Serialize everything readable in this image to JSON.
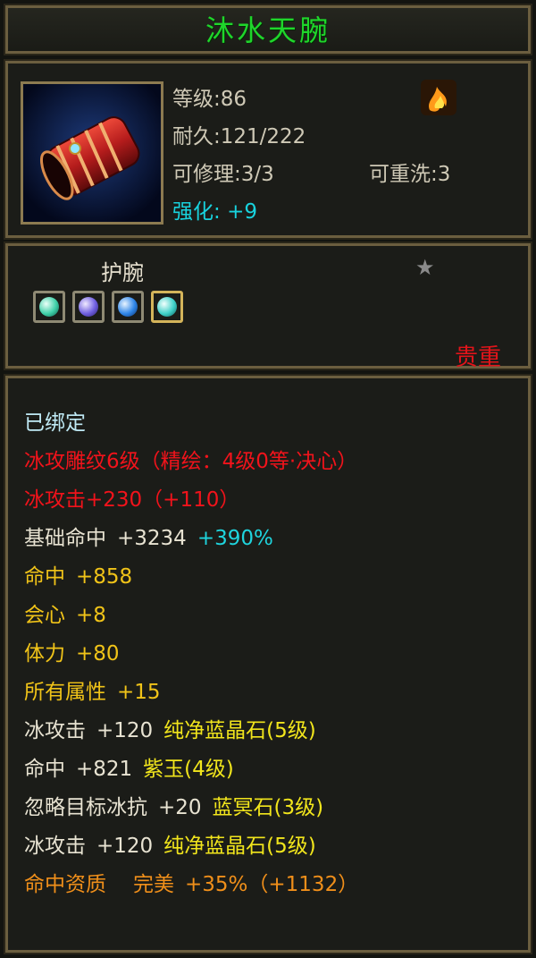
{
  "title": "沐水天腕",
  "info": {
    "level": "等级:86",
    "durability": "耐久:121/222",
    "repairable": "可修理:3/3",
    "rewashable": "可重洗:3",
    "enhance_label": "强化:",
    "enhance_value": "+9"
  },
  "category": "护腕",
  "rarity": "贵重",
  "gem_colors": [
    "#3fd0a8",
    "#6f5fe0",
    "#2f86e8",
    "#3fd0c8"
  ],
  "stats": {
    "bound": "已绑定",
    "engrave": "冰攻雕纹6级（精绘：4级0等·决心）",
    "ice_attack": "冰攻击+230（+110）",
    "base_hit_label": "基础命中",
    "base_hit_value": "+3234",
    "base_hit_pct": "+390%",
    "hit": "命中",
    "hit_value": "+858",
    "crit": "会心",
    "crit_value": "+8",
    "stamina": "体力",
    "stamina_value": "+80",
    "all_attr": "所有属性",
    "all_attr_value": "+15",
    "gem1_attr": "冰攻击",
    "gem1_value": "+120",
    "gem1_name": "纯净蓝晶石",
    "gem1_level": "(5级)",
    "gem2_attr": "命中",
    "gem2_value": "+821",
    "gem2_name": "紫玉",
    "gem2_level": "(4级)",
    "gem3_attr": "忽略目标冰抗",
    "gem3_value": "+20",
    "gem3_name": "蓝冥石",
    "gem3_level": "(3级)",
    "gem4_attr": "冰攻击",
    "gem4_value": "+120",
    "gem4_name": "纯净蓝晶石",
    "gem4_level": "(5级)",
    "aptitude_label": "命中资质",
    "aptitude_grade": "完美",
    "aptitude_value": "+35%（+1132）"
  }
}
